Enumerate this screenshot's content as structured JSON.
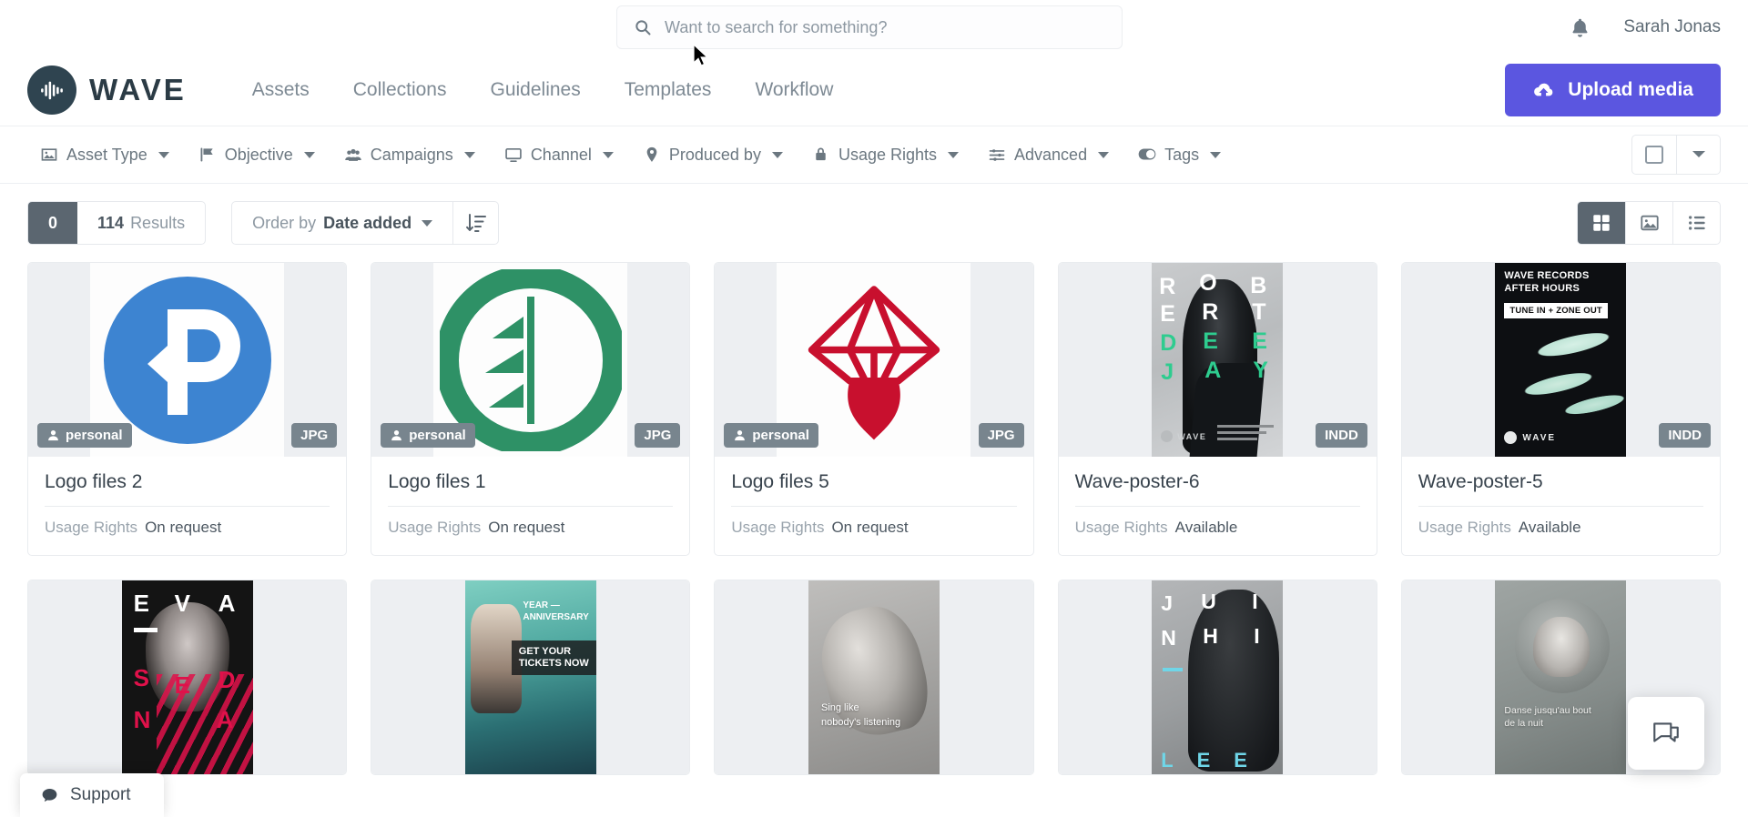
{
  "search": {
    "placeholder": "Want to search for something?",
    "value": "",
    "icon": "search-icon"
  },
  "header": {
    "brand": "WAVE",
    "user_name": "Sarah Jonas",
    "bell_icon": "bell-icon",
    "upload_label": "Upload media",
    "upload_icon": "cloud-upload-icon",
    "accent_color": "#5b56e0",
    "nav": [
      {
        "label": "Assets"
      },
      {
        "label": "Collections"
      },
      {
        "label": "Guidelines"
      },
      {
        "label": "Templates"
      },
      {
        "label": "Workflow"
      }
    ]
  },
  "filters": [
    {
      "label": "Asset Type",
      "icon": "image-icon"
    },
    {
      "label": "Objective",
      "icon": "flag-icon"
    },
    {
      "label": "Campaigns",
      "icon": "users-icon"
    },
    {
      "label": "Channel",
      "icon": "monitor-icon"
    },
    {
      "label": "Produced by",
      "icon": "location-pin-icon"
    },
    {
      "label": "Usage Rights",
      "icon": "lock-icon"
    },
    {
      "label": "Advanced",
      "icon": "sliders-icon"
    },
    {
      "label": "Tags",
      "icon": "toggle-icon"
    }
  ],
  "selection": {
    "checkbox_icon": "checkbox-icon",
    "dropdown_icon": "chevron-down-icon"
  },
  "results": {
    "selected_count": "0",
    "count": "114",
    "count_label": "Results",
    "order_prefix": "Order by",
    "order_value": "Date added",
    "sort_icon": "sort-descending-icon",
    "view_modes": [
      {
        "name": "grid",
        "icon": "grid-icon",
        "active": true
      },
      {
        "name": "gallery",
        "icon": "image-icon",
        "active": false
      },
      {
        "name": "list",
        "icon": "list-icon",
        "active": false
      }
    ]
  },
  "cards": [
    {
      "title": "Logo files 2",
      "meta_label": "Usage Rights",
      "meta_value": "On request",
      "badge_left": "personal",
      "badge_left_icon": "user-icon",
      "badge_right": "JPG",
      "thumb_kind": "logo-p",
      "thumb_color": "#3d84d1"
    },
    {
      "title": "Logo files 1",
      "meta_label": "Usage Rights",
      "meta_value": "On request",
      "badge_left": "personal",
      "badge_left_icon": "user-icon",
      "badge_right": "JPG",
      "thumb_kind": "logo-leaf",
      "thumb_color": "#2e9166"
    },
    {
      "title": "Logo files 5",
      "meta_label": "Usage Rights",
      "meta_value": "On request",
      "badge_left": "personal",
      "badge_left_icon": "user-icon",
      "badge_right": "JPG",
      "thumb_kind": "logo-diamond",
      "thumb_color": "#c8102e"
    },
    {
      "title": "Wave-poster-6",
      "meta_label": "Usage Rights",
      "meta_value": "Available",
      "badge_left": "",
      "badge_right": "INDD",
      "thumb_kind": "poster-robert",
      "poster_lines_white": [
        "R",
        "O",
        "B",
        "E",
        "R",
        "T"
      ],
      "poster_lines_green": [
        "D",
        "E",
        "E",
        "J",
        "A",
        "Y"
      ],
      "poster_logo": "WAVE",
      "accent": "#2ecc8f"
    },
    {
      "title": "Wave-poster-5",
      "meta_label": "Usage Rights",
      "meta_value": "Available",
      "badge_left": "",
      "badge_right": "INDD",
      "thumb_kind": "poster-afterhours",
      "poster_title_1": "WAVE RECORDS",
      "poster_title_2": "AFTER HOURS",
      "poster_tag": "TUNE IN + ZONE OUT",
      "poster_logo": "WAVE"
    }
  ],
  "cards_row2": [
    {
      "thumb_kind": "poster-eva",
      "line1": "E",
      "line2": "V",
      "line3": "A",
      "sub1": "S",
      "sub2": "E",
      "sub3": "D",
      "sub4": "N",
      "sub5": "A"
    },
    {
      "thumb_kind": "poster-anniversary",
      "t1": "YEAR —",
      "t2": "ANNIVERSARY",
      "cta1": "GET YOUR",
      "cta2": "TICKETS NOW"
    },
    {
      "thumb_kind": "poster-sing",
      "t1": "Sing like",
      "t2": "nobody's listening"
    },
    {
      "thumb_kind": "poster-juinhi",
      "l1": "J",
      "l2": "U",
      "l3": "I",
      "l4": "N",
      "l5": "H",
      "l6": "I",
      "sub": "LEE"
    },
    {
      "thumb_kind": "poster-nuit",
      "t1": "Danse jusqu'au bout",
      "t2": "de la nuit"
    }
  ],
  "support": {
    "label": "Support",
    "icon": "chat-bubble-icon"
  },
  "chat": {
    "icon": "chat-icon"
  }
}
